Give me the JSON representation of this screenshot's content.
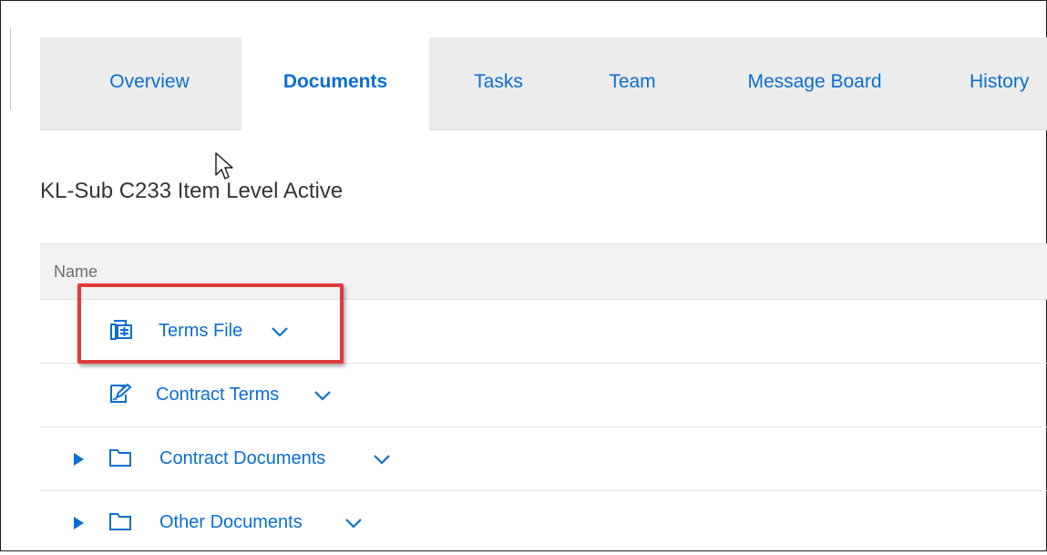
{
  "tabs": [
    {
      "label": "Overview",
      "active": false
    },
    {
      "label": "Documents",
      "active": true
    },
    {
      "label": "Tasks",
      "active": false
    },
    {
      "label": "Team",
      "active": false
    },
    {
      "label": "Message Board",
      "active": false
    },
    {
      "label": "History",
      "active": false
    }
  ],
  "page_title": "KL-Sub C233 Item Level Active",
  "table": {
    "column_name": "Name",
    "rows": [
      {
        "label": "Terms File",
        "icon": "terms-file-icon",
        "expandable": false
      },
      {
        "label": "Contract Terms",
        "icon": "contract-terms-icon",
        "expandable": false
      },
      {
        "label": "Contract Documents",
        "icon": "folder-icon",
        "expandable": true
      },
      {
        "label": "Other Documents",
        "icon": "folder-icon",
        "expandable": true
      }
    ]
  },
  "colors": {
    "accent": "#0a6ed1",
    "highlight": "#e0393e",
    "tabbar_bg": "#ececec"
  }
}
